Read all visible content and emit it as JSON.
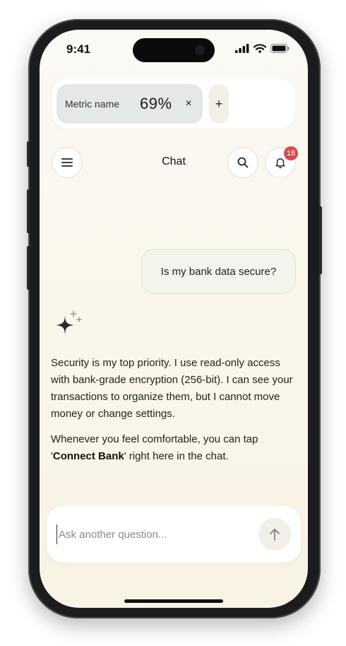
{
  "status": {
    "time": "9:41"
  },
  "metric": {
    "name": "Metric name",
    "value": "69%",
    "close_icon": "×",
    "add_icon": "+"
  },
  "header": {
    "title": "Chat",
    "notification_count": "18"
  },
  "chat": {
    "user_message": "Is my bank data secure?",
    "reply_p1": "Security is my top priority. I use read-only access with bank-grade encryption (256-bit). I can see your transactions to organize them, but I cannot move money or change settings.",
    "reply_p2_pre": "Whenever you feel comfortable, you can tap '",
    "reply_p2_bold": "Connect Bank",
    "reply_p2_post": "' right here in the chat."
  },
  "input": {
    "placeholder": "Ask another question..."
  },
  "colors": {
    "badge": "#d84a4a",
    "chip": "#e5e9e6",
    "background": "#faf6ea"
  },
  "icons": [
    "menu-icon",
    "search-icon",
    "bell-icon",
    "sparkle-icon",
    "arrow-up-icon",
    "signal-icon",
    "wifi-icon",
    "battery-icon"
  ]
}
